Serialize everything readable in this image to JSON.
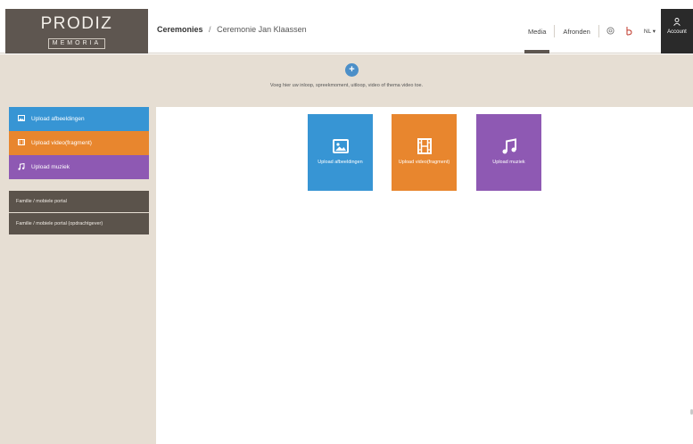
{
  "logo": {
    "main": "PRODIZ",
    "sub": "MEMORIA"
  },
  "breadcrumb": {
    "root": "Ceremonies",
    "separator": "/",
    "current": "Ceremonie Jan Klaassen"
  },
  "nav": {
    "media": "Media",
    "afronden": "Afronden",
    "language": "NL ▾",
    "account": "Account",
    "icons": [
      "help-icon",
      "notification-icon",
      "user-icon"
    ]
  },
  "drop_band": {
    "add_symbol": "+",
    "text": "Voeg hier uw inloop, spreekmoment, uitloop, video of thema video toe."
  },
  "sidebar": {
    "upload_images": "Upload afbeeldingen",
    "upload_video": "Upload video(fragment)",
    "upload_music": "Upload muziek",
    "portal_family": "Familie / mobiele portal",
    "portal_family_client": "Familie / mobiele portal (opdrachtgever)"
  },
  "tiles": {
    "images": "Upload afbeeldingen",
    "video": "Upload video(fragment)",
    "music": "Upload muziek"
  },
  "colors": {
    "logo_bg": "#5e5650",
    "band_bg": "#e6ded3",
    "blue": "#3795d4",
    "orange": "#e8862e",
    "purple": "#8e59b3",
    "dark": "#5b534b",
    "account_bg": "#2a2a2a"
  }
}
